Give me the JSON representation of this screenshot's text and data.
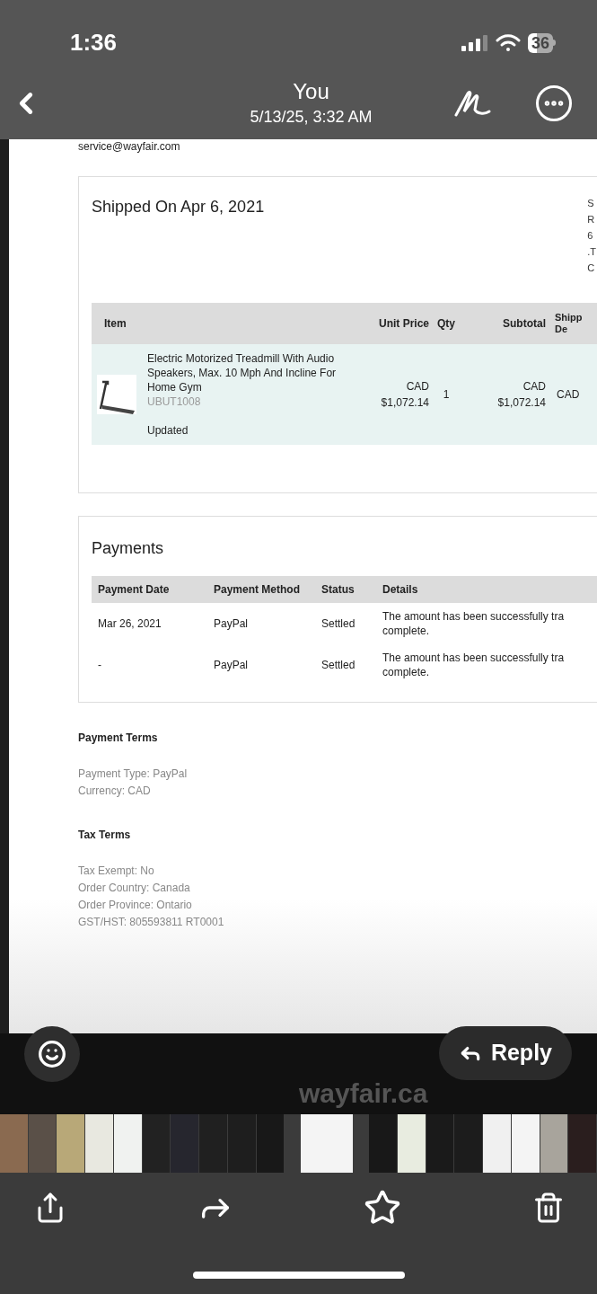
{
  "status_bar": {
    "time": "1:36",
    "battery": "36"
  },
  "header": {
    "title": "You",
    "subtitle": "5/13/25, 3:32 AM"
  },
  "document": {
    "sender_email": "service@wayfair.com",
    "shipment": {
      "title": "Shipped On Apr 6, 2021",
      "address_fragments": [
        "S",
        "R",
        "6",
        ".T",
        "C"
      ],
      "columns": [
        "Item",
        "Unit Price",
        "Qty",
        "Subtotal",
        "Shipp De"
      ],
      "rows": [
        {
          "name": "Electric Motorized Treadmill With Audio Speakers, Max. 10 Mph And Incline For Home Gym",
          "sku": "UBUT1008",
          "note": "Updated",
          "unit_price": "CAD $1,072.14",
          "qty": "1",
          "subtotal": "CAD $1,072.14",
          "column_5": "CAD"
        }
      ]
    },
    "payments": {
      "title": "Payments",
      "columns": [
        "Payment Date",
        "Payment Method",
        "Status",
        "Details"
      ],
      "rows": [
        {
          "date": "Mar 26, 2021",
          "method": "PayPal",
          "status": "Settled",
          "details": [
            "The amount has been successfully tra",
            "complete."
          ]
        },
        {
          "date": "-",
          "method": "PayPal",
          "status": "Settled",
          "details": [
            "The amount has been successfully tra",
            "complete."
          ]
        }
      ]
    },
    "payment_terms": {
      "title": "Payment Terms",
      "lines": [
        "Payment Type: PayPal",
        "Currency: CAD"
      ]
    },
    "tax_terms": {
      "title": "Tax Terms",
      "lines": [
        "Tax Exempt: No",
        "Order Country: Canada",
        "Order Province: Ontario",
        "GST/HST: 805593811 RT0001"
      ]
    }
  },
  "link_domain": "wayfair.ca",
  "reply_button": "Reply"
}
